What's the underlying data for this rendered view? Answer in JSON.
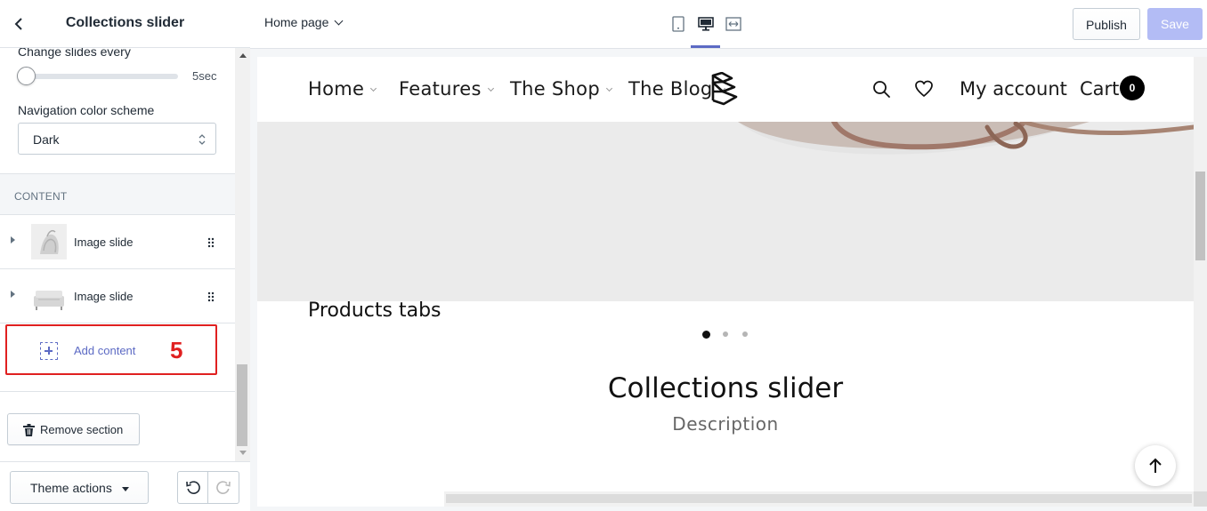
{
  "sidebar": {
    "title": "Collections slider",
    "settings": {
      "change_slides_label": "Change slides every",
      "change_slides_value": "5sec",
      "change_slides_fraction": 0.0,
      "nav_color_label": "Navigation color scheme",
      "nav_color_value": "Dark"
    },
    "content_heading": "CONTENT",
    "blocks": [
      {
        "label": "Image slide",
        "thumb": "bag-pile-thumbnail"
      },
      {
        "label": "Image slide",
        "thumb": "sofa-thumbnail"
      }
    ],
    "add_content_label": "Add content",
    "step_badge": "5",
    "remove_section_label": "Remove section",
    "theme_actions_label": "Theme actions"
  },
  "topbar": {
    "page_selector": "Home page",
    "publish_label": "Publish",
    "save_label": "Save",
    "devices": [
      "mobile-icon",
      "desktop-icon",
      "fullscreen-icon"
    ],
    "active_device": "desktop-icon"
  },
  "preview": {
    "nav": {
      "items": [
        {
          "label": "Home"
        },
        {
          "label": "Features"
        },
        {
          "label": "The Shop"
        },
        {
          "label": "The Blog"
        }
      ],
      "account_label": "My account",
      "cart_label": "Cart",
      "cart_count": "0"
    },
    "slider_dots": {
      "count": 3,
      "active_index": 0
    },
    "products_tabs_title": "Products tabs",
    "collections_title": "Collections slider",
    "collections_description": "Description"
  },
  "colors": {
    "accent": "#5c6ac4",
    "save_disabled": "#b3bcf5",
    "highlight_red": "#e02020",
    "hero_bg": "#ebebeb"
  }
}
